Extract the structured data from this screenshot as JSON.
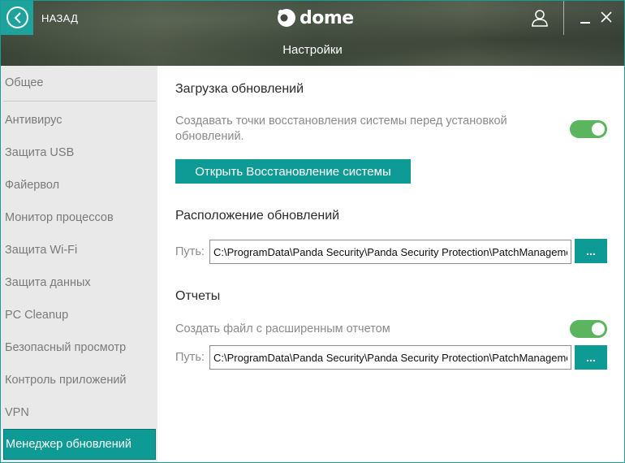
{
  "header": {
    "back_label": "НАЗАД",
    "logo_text": "dome",
    "page_title": "Настройки"
  },
  "sidebar": {
    "items": [
      {
        "label": "Общее"
      },
      {
        "label": "Антивирус"
      },
      {
        "label": "Защита USB"
      },
      {
        "label": "Файервол"
      },
      {
        "label": "Монитор процессов"
      },
      {
        "label": "Защита Wi-Fi"
      },
      {
        "label": "Защита данных"
      },
      {
        "label": "PC Cleanup"
      },
      {
        "label": "Безопасный просмотр"
      },
      {
        "label": "Контроль приложений"
      },
      {
        "label": "VPN"
      },
      {
        "label": "Менеджер обновлений",
        "active": true
      }
    ]
  },
  "content": {
    "updates_download": {
      "title": "Загрузка обновлений",
      "restore_points_text": "Создавать точки восстановления системы перед установкой обновлений.",
      "restore_points_enabled": true,
      "open_restore_button": "Открыть Восстановление системы"
    },
    "updates_location": {
      "title": "Расположение обновлений",
      "path_label": "Путь:",
      "path_value": "C:\\ProgramData\\Panda Security\\Panda Security Protection\\PatchManagement",
      "browse_label": "..."
    },
    "reports": {
      "title": "Отчеты",
      "extended_report_text": "Создать файл с расширенным отчетом",
      "extended_report_enabled": true,
      "path_label": "Путь:",
      "path_value": "C:\\ProgramData\\Panda Security\\Panda Security Protection\\PatchManagement",
      "browse_label": "..."
    }
  },
  "colors": {
    "accent": "#0f9b95",
    "toggle_on": "#5bb55f",
    "sidebar_bg": "#e9e9e9"
  }
}
